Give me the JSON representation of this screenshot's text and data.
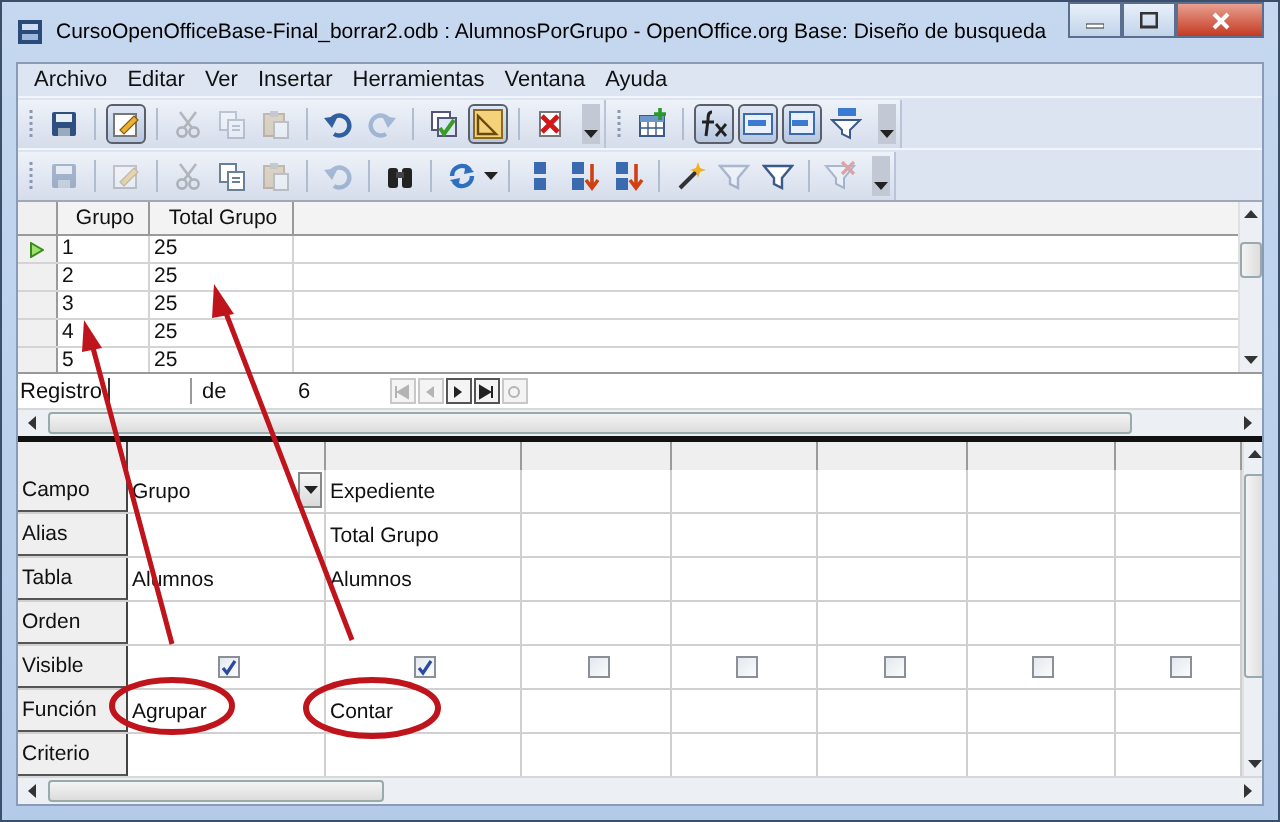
{
  "window": {
    "title": "CursoOpenOfficeBase-Final_borrar2.odb : AlumnosPorGrupo - OpenOffice.org Base: Diseño de busqueda"
  },
  "menu": [
    {
      "label": "Archivo"
    },
    {
      "label": "Editar"
    },
    {
      "label": "Ver"
    },
    {
      "label": "Insertar"
    },
    {
      "label": "Herramientas"
    },
    {
      "label": "Ventana"
    },
    {
      "label": "Ayuda"
    }
  ],
  "toolbars": [
    [
      {
        "on": false,
        "disabled": false
      },
      {
        "on": true,
        "disabled": false
      },
      {
        "on": false,
        "disabled": true
      },
      {
        "on": false,
        "disabled": true
      },
      {
        "on": false,
        "disabled": true
      },
      {
        "on": false,
        "disabled": false
      },
      {
        "on": false,
        "disabled": true
      },
      {
        "on": false,
        "disabled": false
      },
      {
        "on": true,
        "disabled": false
      },
      {
        "on": false,
        "disabled": false
      },
      {
        "on": false,
        "disabled": false
      },
      {
        "on": true,
        "disabled": false
      },
      {
        "on": true,
        "disabled": false
      },
      {
        "on": true,
        "disabled": false
      },
      {
        "on": false,
        "disabled": false
      }
    ],
    [
      {
        "on": false,
        "disabled": true
      },
      {
        "on": false,
        "disabled": true
      },
      {
        "on": false,
        "disabled": true
      },
      {
        "on": false,
        "disabled": false
      },
      {
        "on": false,
        "disabled": true
      },
      {
        "on": false,
        "disabled": true
      },
      {
        "on": false,
        "disabled": false
      },
      {
        "on": false,
        "disabled": false
      },
      {
        "on": false,
        "disabled": false
      },
      {
        "on": false,
        "disabled": false
      },
      {
        "on": false,
        "disabled": false
      },
      {
        "on": false,
        "disabled": false
      },
      {
        "on": false,
        "disabled": true
      },
      {
        "on": false,
        "disabled": false
      },
      {
        "on": false,
        "disabled": true
      }
    ]
  ],
  "results": {
    "columns": [
      "Grupo",
      "Total Grupo"
    ],
    "rows": [
      {
        "cells": [
          "1",
          "25"
        ],
        "selected": true
      },
      {
        "cells": [
          "2",
          "25"
        ],
        "selected": false
      },
      {
        "cells": [
          "3",
          "25"
        ],
        "selected": false
      },
      {
        "cells": [
          "4",
          "25"
        ],
        "selected": false
      },
      {
        "cells": [
          "5",
          "25"
        ],
        "selected": false
      }
    ]
  },
  "navigator": {
    "label": "Registro",
    "of": "de",
    "total": "6",
    "buttons": [
      {
        "disabled": true
      },
      {
        "disabled": true
      },
      {
        "disabled": false
      },
      {
        "disabled": false
      },
      {
        "disabled": true
      }
    ]
  },
  "design": {
    "row_labels": [
      "Campo",
      "Alias",
      "Tabla",
      "Orden",
      "Visible",
      "Función",
      "Criterio"
    ],
    "columns": [
      {
        "field": "Grupo",
        "table": "Alumnos",
        "visible": true,
        "function": "Agrupar",
        "selected": true
      },
      {
        "field": "Expediente",
        "alias": "Total Grupo",
        "table": "Alumnos",
        "visible": true,
        "function": "Contar",
        "selected": false
      },
      {
        "visible": false,
        "selected": false
      },
      {
        "visible": false,
        "selected": false
      },
      {
        "visible": false,
        "selected": false
      },
      {
        "visible": false,
        "selected": false
      },
      {
        "visible": false,
        "selected": false
      }
    ]
  }
}
